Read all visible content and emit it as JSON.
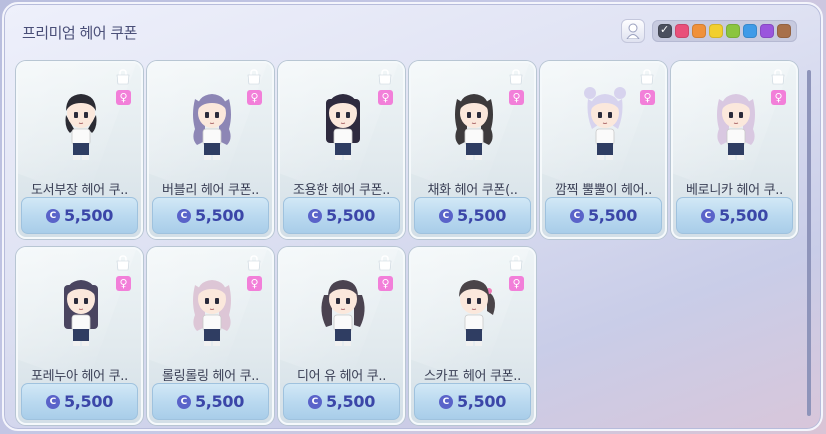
{
  "panel": {
    "title": "프리미엄 헤어 쿠폰"
  },
  "toolbar": {
    "gender_icon": "person-icon",
    "swatches": [
      {
        "name": "all",
        "color": "#4b4f5e",
        "selected": true
      },
      {
        "name": "red",
        "color": "#e9507a"
      },
      {
        "name": "orange",
        "color": "#f0913a"
      },
      {
        "name": "yellow",
        "color": "#f2cf2e"
      },
      {
        "name": "green",
        "color": "#8bc53f"
      },
      {
        "name": "blue",
        "color": "#3f9be8"
      },
      {
        "name": "purple",
        "color": "#9a55dd"
      },
      {
        "name": "brown",
        "color": "#a8704a"
      }
    ]
  },
  "items": [
    {
      "name": "도서부장 헤어 쿠..",
      "price": "5,500",
      "hair": "#2b2b33",
      "style": "short"
    },
    {
      "name": "버블리 헤어 쿠폰..",
      "price": "5,500",
      "hair": "#8d86b5",
      "style": "wavy"
    },
    {
      "name": "조용한 헤어 쿠폰..",
      "price": "5,500",
      "hair": "#2e2a3e",
      "style": "straight"
    },
    {
      "name": "채화 헤어 쿠폰(..",
      "price": "5,500",
      "hair": "#3d3a3c",
      "style": "wavy"
    },
    {
      "name": "깜찍 뿔뿔이 헤어..",
      "price": "5,500",
      "hair": "#d7d3ee",
      "style": "buns"
    },
    {
      "name": "베로니카 헤어 쿠..",
      "price": "5,500",
      "hair": "#d9c8e1",
      "style": "wavy"
    },
    {
      "name": "포레누아 헤어 쿠..",
      "price": "5,500",
      "hair": "#4a4560",
      "style": "straight"
    },
    {
      "name": "롤링롤링 헤어 쿠..",
      "price": "5,500",
      "hair": "#ddc6d6",
      "style": "wavy"
    },
    {
      "name": "디어 유 헤어 쿠..",
      "price": "5,500",
      "hair": "#4b4350",
      "style": "twin"
    },
    {
      "name": "스카프 헤어 쿠폰..",
      "price": "5,500",
      "hair": "#4a4448",
      "style": "ponytail"
    }
  ],
  "icons": {
    "bag": "shopping-bag-icon",
    "female": "♀",
    "coin": "C"
  }
}
